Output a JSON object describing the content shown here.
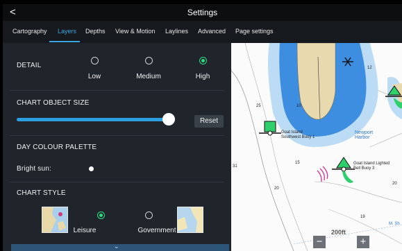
{
  "header": {
    "title": "Settings",
    "back_icon": "chevron-left-icon"
  },
  "tabs": [
    {
      "label": "Cartography"
    },
    {
      "label": "Layers",
      "active": true
    },
    {
      "label": "Depths"
    },
    {
      "label": "View & Motion"
    },
    {
      "label": "Laylines"
    },
    {
      "label": "Advanced"
    },
    {
      "label": "Page settings"
    }
  ],
  "detail": {
    "title": "DETAIL",
    "options": [
      {
        "label": "Low"
      },
      {
        "label": "Medium"
      },
      {
        "label": "High"
      }
    ],
    "selected": "High"
  },
  "chart_object_size": {
    "title": "CHART OBJECT SIZE",
    "level_fraction": 0.95,
    "reset_label": "Reset"
  },
  "day_colour_palette": {
    "title": "DAY COLOUR PALETTE",
    "value": "Bright sun:"
  },
  "chart_style": {
    "title": "CHART STYLE",
    "options": [
      {
        "label": "Leisure"
      },
      {
        "label": "Government"
      }
    ],
    "selected": "Leisure"
  },
  "map": {
    "labels": {
      "goat_island_buoy": "Goat Island\nSouthwest Buoy 1",
      "newport_harbor": "Newport\nHarbor",
      "goat_island_bell": "Goat Island Lighted\nBell Buoy 3",
      "scale": "200ft",
      "corner": "M. Sh"
    },
    "depths": [
      "25",
      "31",
      "15",
      "20",
      "19",
      "20",
      "12",
      "10"
    ],
    "zoom_out": "−",
    "zoom_in": "+"
  },
  "colors": {
    "accent": "#3ba6e0",
    "radio_selected": "#2fdc83",
    "buoy_green": "#2fd06c",
    "water_deep": "#3d8ee0",
    "land": "#e9d9ae"
  }
}
